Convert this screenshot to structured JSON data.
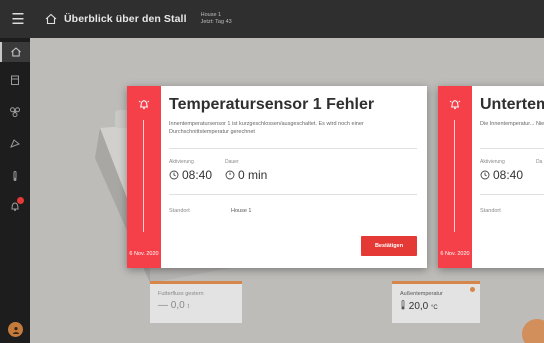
{
  "header": {
    "title": "Überblick über den Stall",
    "house_line1": "House 1",
    "house_line2": "Jetzt: Tag 43"
  },
  "sidebar": {
    "items": [
      {
        "icon": "home-icon",
        "active": true
      },
      {
        "icon": "barn-icon"
      },
      {
        "icon": "fan-icon"
      },
      {
        "icon": "feed-icon"
      },
      {
        "icon": "thermometer-icon"
      },
      {
        "icon": "alarm-icon",
        "badge": true
      }
    ]
  },
  "cards": [
    {
      "title": "Temperatursensor 1 Fehler",
      "description": "Innentemperatursensor 1 ist kurzgeschlossen/ausgeschaltet. Es wird noch einer Durchschnittstemperatur gerechnet",
      "activation_label": "Aktivierung",
      "activation_value": "08:40",
      "duration_label": "Dauer",
      "duration_value": "0 min",
      "location_label": "Standort",
      "location_value": "House 1",
      "confirm_label": "Bestätigen",
      "date": "6 Nov. 2020"
    },
    {
      "title": "Untertem",
      "description": "Die Innentemperatur... Niedrige Temperat...",
      "activation_label": "Aktivierung",
      "activation_value": "08:40",
      "duration_label": "Da",
      "location_label": "Standort",
      "date": "6 Nov. 2020"
    }
  ],
  "tiles": [
    {
      "label": "Futterfluss gestern",
      "value": "— 0,0",
      "unit": "t"
    },
    {
      "label": "Außentemperatur",
      "value": "20,0",
      "unit": "°C"
    }
  ],
  "colors": {
    "alarm": "#f5404a",
    "accent": "#d6864a",
    "sidebar": "#1d1d1d",
    "topbar": "#2f2f2f"
  }
}
